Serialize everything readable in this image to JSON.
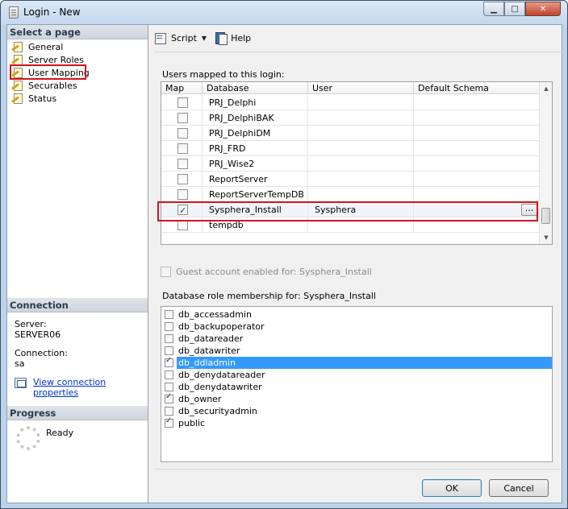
{
  "window": {
    "title": "Login - New"
  },
  "left": {
    "select_page_header": "Select a page",
    "pages": [
      {
        "label": "General"
      },
      {
        "label": "Server Roles"
      },
      {
        "label": "User Mapping"
      },
      {
        "label": "Securables"
      },
      {
        "label": "Status"
      }
    ],
    "selected_page": "User Mapping",
    "connection_header": "Connection",
    "server_label": "Server:",
    "server_value": "SERVER06",
    "connection_label": "Connection:",
    "connection_value": "sa",
    "view_connection_link": "View connection properties",
    "progress_header": "Progress",
    "progress_status": "Ready"
  },
  "toolbar": {
    "script_label": "Script",
    "help_label": "Help"
  },
  "mapping": {
    "label": "Users mapped to this login:",
    "columns": [
      "Map",
      "Database",
      "User",
      "Default Schema"
    ],
    "rows": [
      {
        "checked": false,
        "database": "PRJ_Delphi",
        "user": "",
        "schema": ""
      },
      {
        "checked": false,
        "database": "PRJ_DelphiBAK",
        "user": "",
        "schema": ""
      },
      {
        "checked": false,
        "database": "PRJ_DelphiDM",
        "user": "",
        "schema": ""
      },
      {
        "checked": false,
        "database": "PRJ_FRD",
        "user": "",
        "schema": ""
      },
      {
        "checked": false,
        "database": "PRJ_Wise2",
        "user": "",
        "schema": ""
      },
      {
        "checked": false,
        "database": "ReportServer",
        "user": "",
        "schema": ""
      },
      {
        "checked": false,
        "database": "ReportServerTempDB",
        "user": "",
        "schema": ""
      },
      {
        "checked": true,
        "database": "Sysphera_Install",
        "user": "Sysphera",
        "schema": "",
        "schema_button": "..."
      },
      {
        "checked": false,
        "database": "tempdb",
        "user": "",
        "schema": ""
      }
    ]
  },
  "guest": {
    "label": "Guest account enabled for: Sysphera_Install",
    "checked": false,
    "enabled": false
  },
  "roles": {
    "label": "Database role membership for: Sysphera_Install",
    "items": [
      {
        "name": "db_accessadmin",
        "checked": false
      },
      {
        "name": "db_backupoperator",
        "checked": false
      },
      {
        "name": "db_datareader",
        "checked": false
      },
      {
        "name": "db_datawriter",
        "checked": false
      },
      {
        "name": "db_ddladmin",
        "checked": true,
        "selected": true
      },
      {
        "name": "db_denydatareader",
        "checked": false
      },
      {
        "name": "db_denydatawriter",
        "checked": false
      },
      {
        "name": "db_owner",
        "checked": true
      },
      {
        "name": "db_securityadmin",
        "checked": false
      },
      {
        "name": "public",
        "checked": true
      }
    ]
  },
  "buttons": {
    "ok": "OK",
    "cancel": "Cancel"
  }
}
